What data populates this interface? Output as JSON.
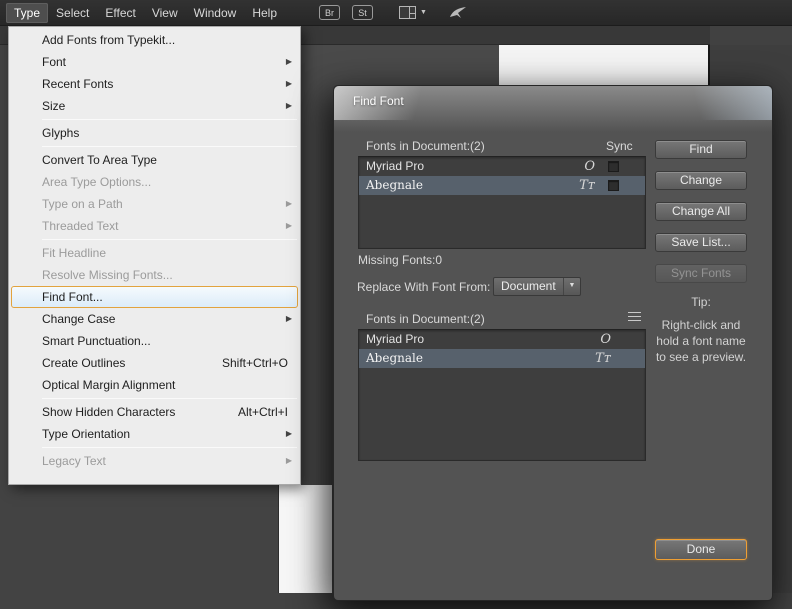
{
  "colors": {
    "accent_orange": "#EF9F34",
    "selected_row": "#57616C",
    "menu_highlight_border": "#E2A33E"
  },
  "icons": {
    "submenu_arrow": "▶",
    "dropdown_caret": "▼",
    "workspace_caret": "▼",
    "opentype_glyph": "O",
    "truetype_glyph": "Tᴛ",
    "bridge": "Br",
    "stock": "St"
  },
  "menubar": {
    "items": [
      "Type",
      "Select",
      "Effect",
      "View",
      "Window",
      "Help"
    ]
  },
  "type_menu": {
    "items": [
      {
        "label": "Add Fonts from Typekit..."
      },
      {
        "label": "Font",
        "submenu": true
      },
      {
        "label": "Recent Fonts",
        "submenu": true
      },
      {
        "label": "Size",
        "submenu": true
      },
      {
        "label": "Glyphs"
      },
      {
        "label": "Convert To Area Type"
      },
      {
        "label": "Area Type Options...",
        "disabled": true
      },
      {
        "label": "Type on a Path",
        "disabled": true,
        "submenu": true
      },
      {
        "label": "Threaded Text",
        "disabled": true,
        "submenu": true
      },
      {
        "label": "Fit Headline",
        "disabled": true
      },
      {
        "label": "Resolve Missing Fonts...",
        "disabled": true
      },
      {
        "label": "Find Font...",
        "highlighted": true
      },
      {
        "label": "Change Case",
        "submenu": true
      },
      {
        "label": "Smart Punctuation..."
      },
      {
        "label": "Create Outlines",
        "shortcut": "Shift+Ctrl+O"
      },
      {
        "label": "Optical Margin Alignment"
      },
      {
        "label": "Show Hidden Characters",
        "shortcut": "Alt+Ctrl+I"
      },
      {
        "label": "Type Orientation",
        "submenu": true
      },
      {
        "label": "Legacy Text",
        "disabled": true,
        "submenu": true
      }
    ]
  },
  "dialog": {
    "title": "Find Font",
    "section1_label": "Fonts in Document:(2)",
    "sync_label": "Sync",
    "list1": {
      "rows": [
        {
          "name": "Myriad Pro",
          "type": "opentype"
        },
        {
          "name": "Abegnale",
          "type": "truetype",
          "selected": true
        }
      ]
    },
    "missing_label": "Missing Fonts:0",
    "replace_label": "Replace With Font From:",
    "replace_value": "Document",
    "section2_label": "Fonts in Document:(2)",
    "list2": {
      "rows": [
        {
          "name": "Myriad Pro",
          "type": "opentype"
        },
        {
          "name": "Abegnale",
          "type": "truetype",
          "selected": true
        }
      ]
    },
    "buttons": {
      "find": "Find",
      "change": "Change",
      "change_all": "Change All",
      "save_list": "Save List...",
      "sync_fonts": "Sync Fonts",
      "done": "Done"
    },
    "tip": {
      "title": "Tip:",
      "line1": "Right-click and",
      "line2": "hold a font name",
      "line3": "to see a preview."
    }
  }
}
